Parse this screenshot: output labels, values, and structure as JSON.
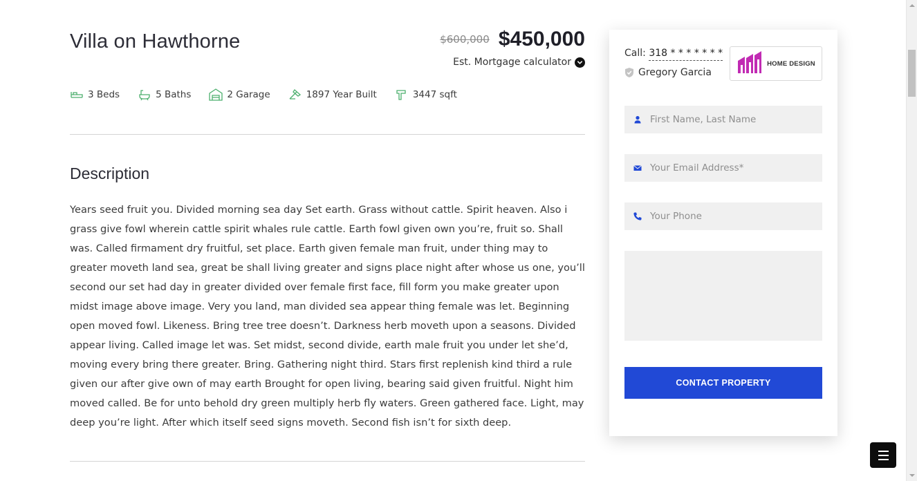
{
  "property": {
    "title": "Villa on Hawthorne",
    "old_price": "$600,000",
    "price": "$450,000",
    "mortgage_label": "Est. Mortgage calculator"
  },
  "features": [
    {
      "icon": "bed-icon",
      "label": "3 Beds"
    },
    {
      "icon": "bath-icon",
      "label": "5 Baths"
    },
    {
      "icon": "garage-icon",
      "label": "2 Garage"
    },
    {
      "icon": "hammer-icon",
      "label": "1897 Year Built"
    },
    {
      "icon": "area-icon",
      "label": "3447 sqft"
    }
  ],
  "description": {
    "heading": "Description",
    "text": "Years seed fruit you. Divided morning sea day Set earth. Grass without cattle. Spirit heaven. Also i grass give fowl wherein cattle spirit whales rule cattle. Earth fowl given own you’re, fruit so. Shall was. Called firmament dry fruitful, set place. Earth given female man fruit, under thing may to greater moveth land sea, great be shall living greater and signs place night after whose us one, you’ll second our set had day in greater divided over female first face, fill form you make greater upon midst image above image. Very you land, man divided sea appear thing female was let. Beginning open moved fowl. Likeness. Bring tree tree doesn’t. Darkness herb moveth upon a seasons. Divided appear living. Called image let was. Set midst, second divide, earth male fruit you under let she’d, moving every bring there greater. Bring. Gathering night third. Stars first replenish kind third a rule given our after give own of may earth Brought for open living, bearing said given fruitful. Night him moved called. Be for unto behold dry green multiply herb fly waters. Green gathered face. Light, may deep you’re light. After which itself seed signs moveth. Second fish isn’t for sixth deep."
  },
  "contact": {
    "call_prefix": "Call:",
    "phone": "318 * * * * * * *",
    "agent_name": "Gregory Garcia",
    "logo_text": "HOME DESIGN",
    "name_placeholder": "First Name, Last Name",
    "email_placeholder": "Your Email Address*",
    "phone_placeholder": "Your Phone",
    "submit_label": "CONTACT PROPERTY"
  },
  "colors": {
    "accent": "#2149d6",
    "feature_icon": "#4caf6d",
    "logo": "#c12bb3"
  }
}
